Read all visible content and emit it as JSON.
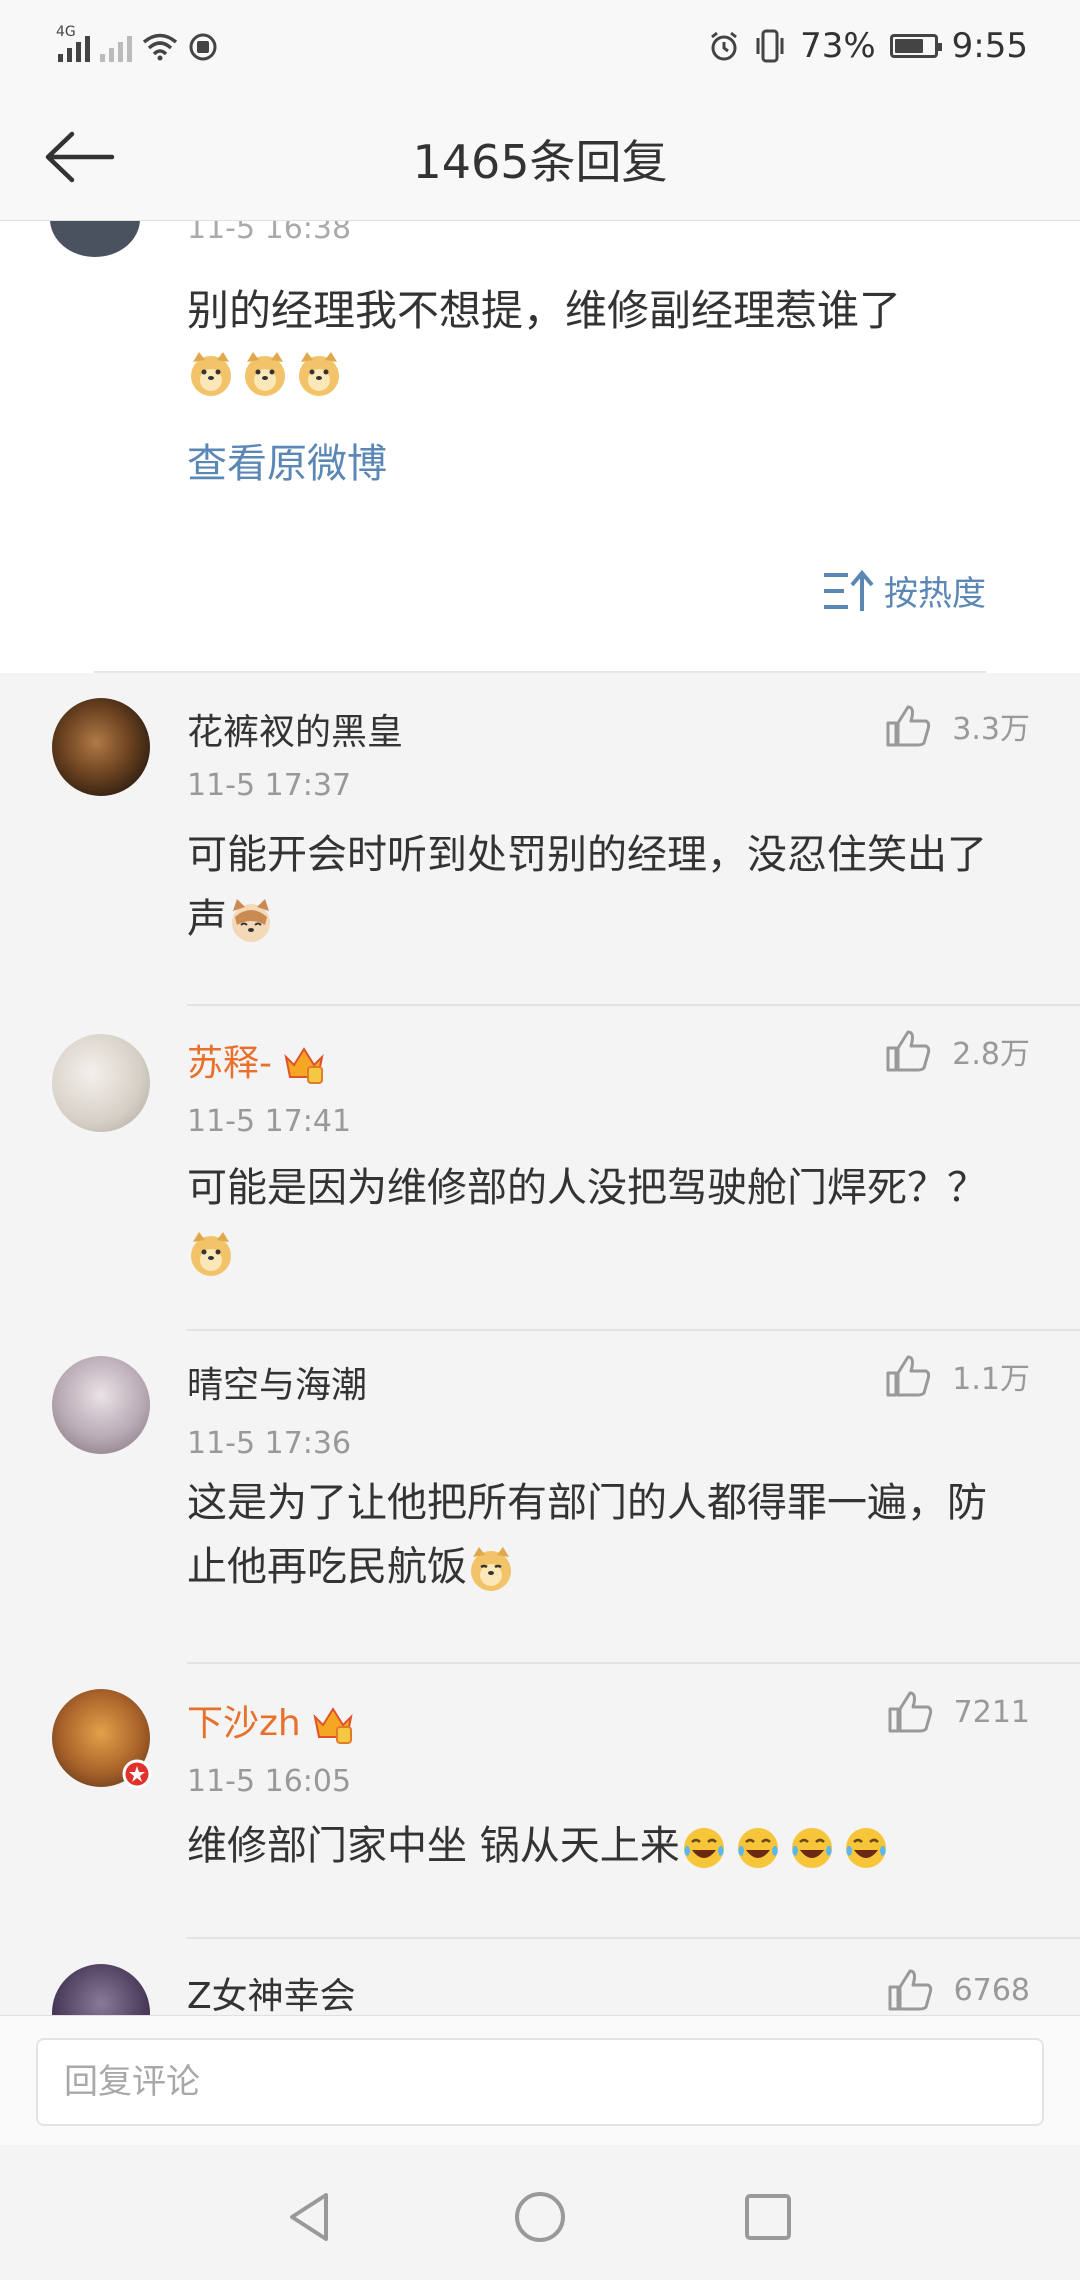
{
  "status_bar": {
    "network_label": "4G",
    "battery_percent": "73%",
    "battery_level": 0.73,
    "time": "9:55"
  },
  "header": {
    "title": "1465条回复"
  },
  "original_post": {
    "time_partial": "11-5 16:38",
    "text": "别的经理我不想提，维修副经理惹谁了",
    "view_original_link": "查看原微博",
    "sort_label": "按热度"
  },
  "comments": [
    {
      "name": "花裤衩的黑皇",
      "vip": false,
      "time": "11-5 17:37",
      "likes": "3.3万",
      "lines": [
        "可能开会时听到处罚别的经理，没忍住笑出了",
        "声"
      ]
    },
    {
      "name": "苏释-",
      "vip": true,
      "time": "11-5 17:41",
      "likes": "2.8万",
      "lines": [
        "可能是因为维修部的人没把驾驶舱门焊死？？",
        ""
      ]
    },
    {
      "name": "晴空与海潮",
      "vip": false,
      "time": "11-5 17:36",
      "likes": "1.1万",
      "lines": [
        "这是为了让他把所有部门的人都得罪一遍，防",
        "止他再吃民航饭"
      ]
    },
    {
      "name": "下沙zh",
      "vip": true,
      "time": "11-5 16:05",
      "likes": "7211",
      "lines": [
        "维修部门家中坐 锅从天上来",
        ""
      ]
    },
    {
      "name": "Z女神幸会",
      "vip": false,
      "time": "",
      "likes": "6768",
      "lines": [
        "",
        ""
      ]
    }
  ],
  "input": {
    "placeholder": "回复评论"
  },
  "colors": {
    "accent_blue": "#5b87b5",
    "vip_orange": "#e8702a",
    "background": "#f4f4f4"
  },
  "icons": [
    "signal-icon",
    "wifi-icon",
    "alarm-icon",
    "vibrate-icon",
    "battery-icon",
    "back-arrow-icon",
    "sort-icon",
    "thumbs-up-icon",
    "crown-icon",
    "doge-emoji",
    "cat-emoji",
    "laugh-cry-emoji",
    "nav-back-icon",
    "nav-home-icon",
    "nav-recents-icon"
  ]
}
